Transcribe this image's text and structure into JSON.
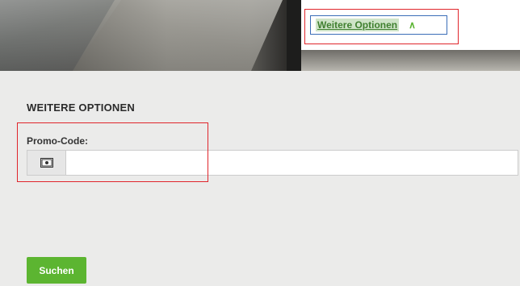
{
  "header": {
    "more_options_link": "Weitere Optionen",
    "chevron_icon": "chevron-up-icon"
  },
  "options": {
    "section_title": "WEITERE OPTIONEN",
    "promo_label": "Promo-Code:",
    "promo_icon": "ticket-icon",
    "promo_value": "",
    "promo_placeholder": ""
  },
  "actions": {
    "search_label": "Suchen"
  },
  "colors": {
    "accent_green": "#5cb531",
    "link_green": "#3f7f2f",
    "highlight_red": "#e0252b"
  }
}
